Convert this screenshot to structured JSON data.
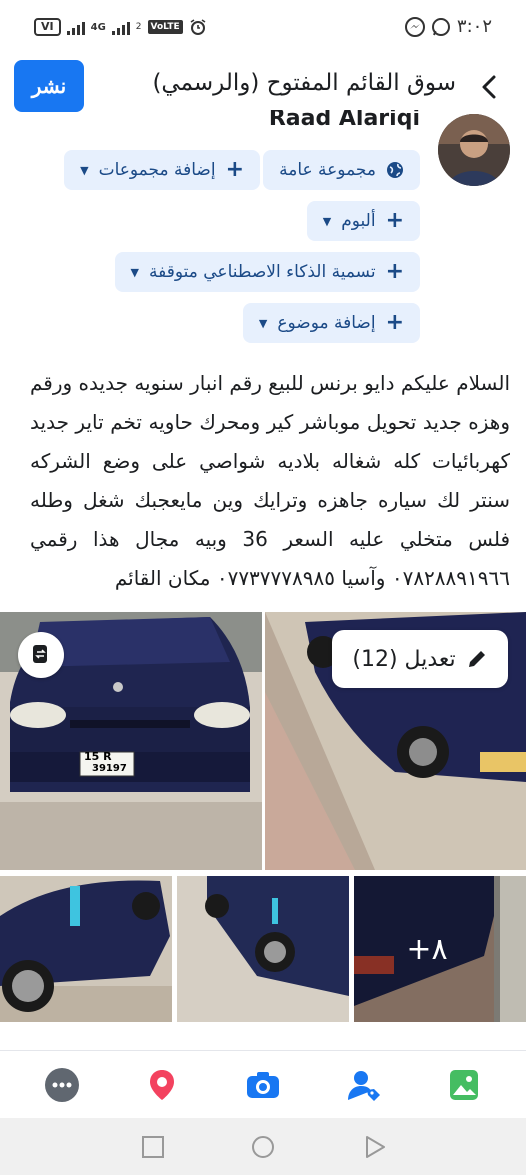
{
  "status_bar": {
    "carrier": "VI",
    "network": "4G",
    "sim": "2",
    "volte": "VoLTE",
    "time": "٣:٠٢"
  },
  "header": {
    "publish_label": "نشر",
    "title": "سوق القائم المفتوح (والرسمي)",
    "back_icon": "chevron-right-icon"
  },
  "profile": {
    "name": "Raad Alariqi"
  },
  "chips": {
    "audience": "مجموعة عامة",
    "add_groups": "إضافة مجموعات",
    "album": "ألبوم",
    "ai_label": "تسمية الذكاء الاصطناعي متوقفة",
    "add_topic": "إضافة موضوع",
    "plus": "+"
  },
  "post": {
    "text": "السلام عليكم دايو برنس للبيع رقم انبار سنويه جديده ورقم وهزه جديد تحويل موباشر كير ومحرك حاويه تخم تاير جديد كهربائيات كله شغاله بلاديه شواصي على وضع الشركه سنتر لك سياره جاهزه وترايك وين مايعجبك شغل وطله فلس متخلي عليه السعر 36 وبيه مجال هذا رقمي ٠٧٨٢٨٨٩١٩٦٦ وآسيا ٠٧٧٣٧٧٧٨٩٨٥ مكان القائم"
  },
  "photos": {
    "edit_label": "تعديل (12)",
    "plate_top": "15  R",
    "plate_bottom": "39197",
    "more_count": "+٨"
  },
  "actions": [
    {
      "name": "more-icon",
      "color": "#606770"
    },
    {
      "name": "location-icon",
      "color": "#f3425f"
    },
    {
      "name": "camera-icon",
      "color": "#1877f2"
    },
    {
      "name": "tag-people-icon",
      "color": "#1877f2"
    },
    {
      "name": "photo-icon",
      "color": "#45bd62"
    }
  ],
  "colors": {
    "primary": "#1877f2",
    "chip_bg": "#e7f0fd",
    "chip_text": "#1b4a87"
  }
}
